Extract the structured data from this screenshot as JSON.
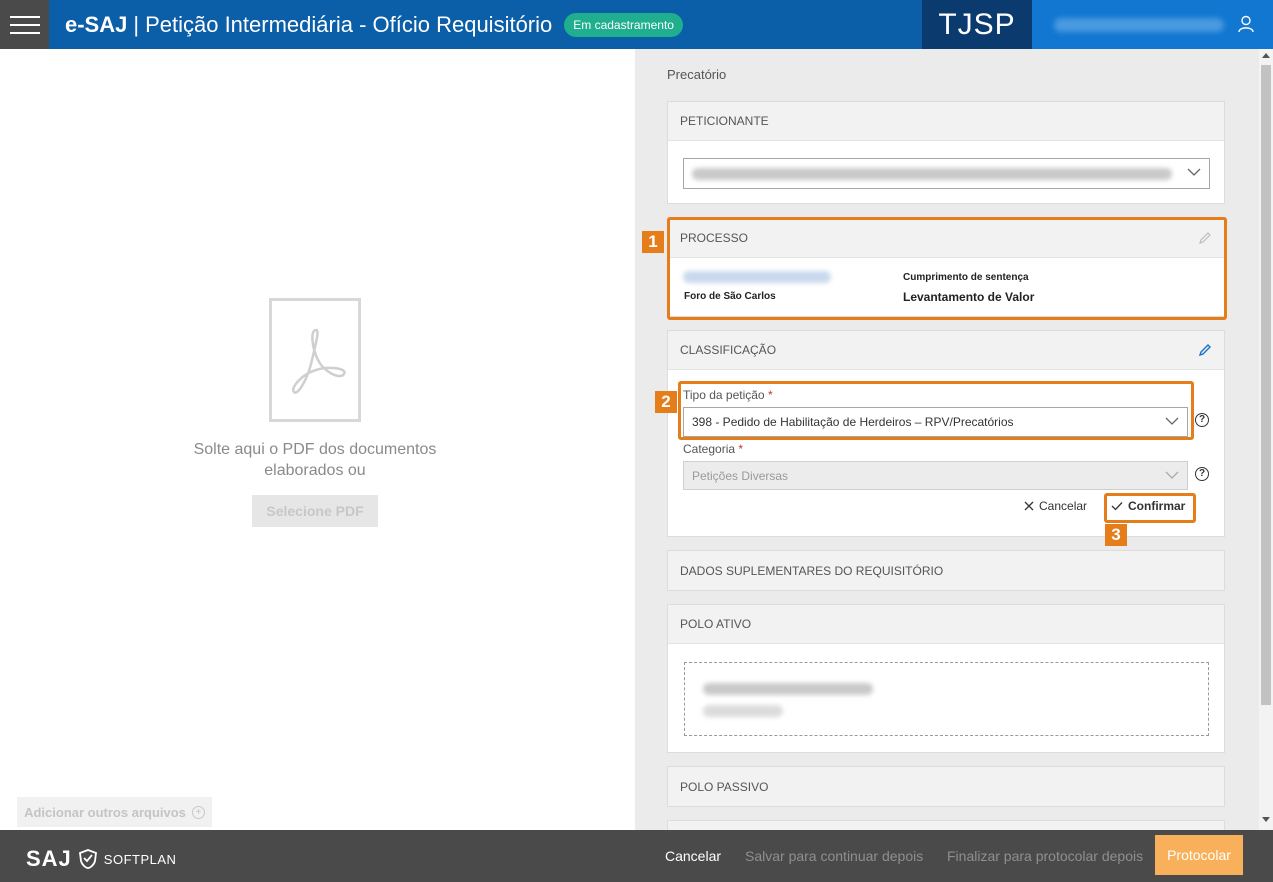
{
  "header": {
    "brand": "e-SAJ",
    "separator": "|",
    "title": "Petição Intermediária - Ofício Requisitório",
    "status_badge": "Em cadastramento",
    "court": "TJSP",
    "menu_icon": "hamburger-icon",
    "user_icon": "user-icon"
  },
  "left": {
    "drop_text": "Solte aqui o PDF dos documentos elaborados ou",
    "select_pdf_label": "Selecione PDF",
    "add_files_label": "Adicionar outros arquivos",
    "pdf_icon": "acrobat-pdf-icon"
  },
  "right": {
    "section_title": "Precatório",
    "peticionante": {
      "header": "PETICIONANTE"
    },
    "processo": {
      "header": "PROCESSO",
      "foro": "Foro de São Carlos",
      "classe": "Cumprimento de sentença",
      "assunto": "Levantamento de Valor"
    },
    "classificacao": {
      "header": "CLASSIFICAÇÃO",
      "tipo_label": "Tipo da petição",
      "tipo_value": "398 - Pedido de Habilitação de Herdeiros – RPV/Precatórios",
      "categoria_label": "Categoria",
      "categoria_value": "Petições Diversas",
      "required_mark": "*",
      "help_mark": "?",
      "cancel_label": "Cancelar",
      "confirm_label": "Confirmar"
    },
    "dados_suplementares": {
      "header": "DADOS SUPLEMENTARES DO REQUISITÓRIO"
    },
    "polo_ativo": {
      "header": "POLO ATIVO"
    },
    "polo_passivo": {
      "header": "POLO PASSIVO"
    }
  },
  "annotations": [
    "1",
    "2",
    "3"
  ],
  "footer": {
    "logo_saj": "SAJ",
    "logo_softplan": "SOFTPLAN",
    "cancel": "Cancelar",
    "save_later": "Salvar para continuar depois",
    "finalize_later": "Finalizar para protocolar depois",
    "protocolar": "Protocolar"
  },
  "colors": {
    "header_blue": "#0b5ea8",
    "court_blue": "#0a3a6e",
    "badge_green": "#1fae8e",
    "highlight_orange": "#e47d1a",
    "protocolar_orange": "#f8b15a",
    "footer_gray": "#4a4a4a"
  }
}
